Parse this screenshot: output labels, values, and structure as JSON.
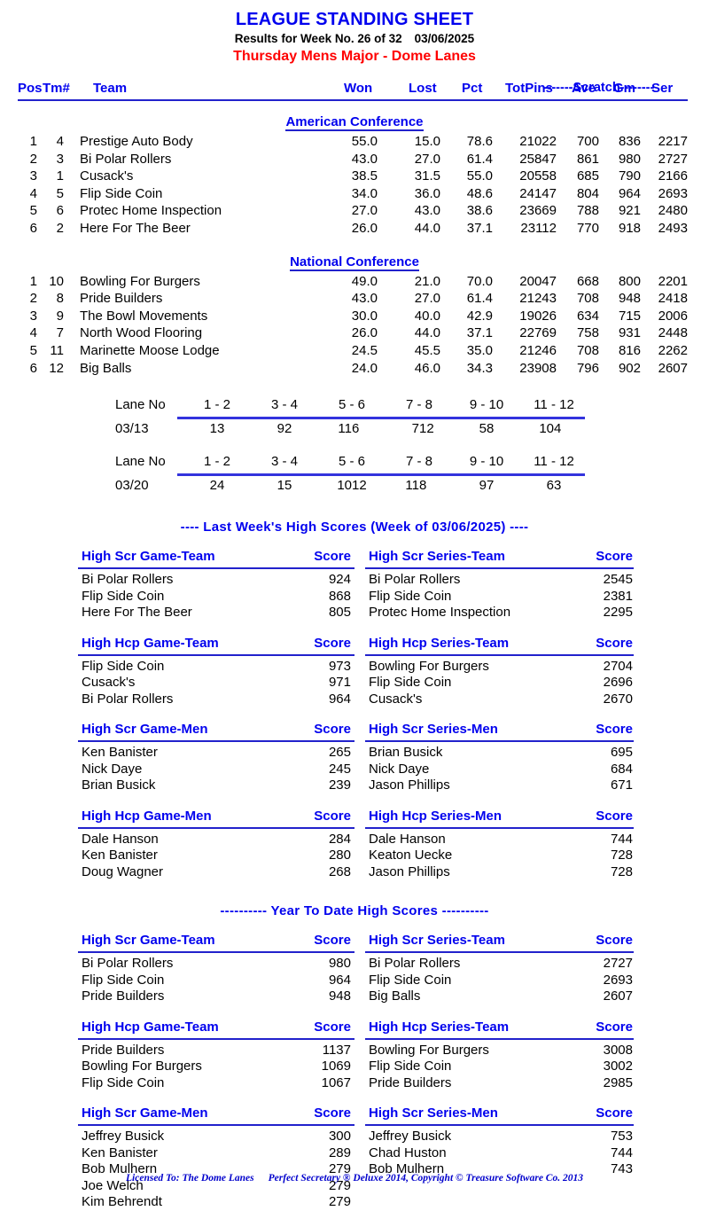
{
  "header": {
    "title": "LEAGUE STANDING SHEET",
    "results_label": "Results for Week No. 26 of 32",
    "results_date": "03/06/2025",
    "league_name": "Thursday Mens Major - Dome Lanes"
  },
  "standings": {
    "scratch_label": "-------Scratch--------",
    "columns": {
      "pos": "Pos",
      "tm": "Tm#",
      "team": "Team",
      "won": "Won",
      "lost": "Lost",
      "pct": "Pct",
      "totpins": "TotPins",
      "ave": "Ave",
      "gm": "Gm",
      "ser": "Ser"
    },
    "conferences": [
      {
        "name": "American Conference",
        "rows": [
          {
            "pos": "1",
            "tm": "4",
            "team": "Prestige Auto Body",
            "won": "55.0",
            "lost": "15.0",
            "pct": "78.6",
            "totpins": "21022",
            "ave": "700",
            "gm": "836",
            "ser": "2217"
          },
          {
            "pos": "2",
            "tm": "3",
            "team": "Bi Polar Rollers",
            "won": "43.0",
            "lost": "27.0",
            "pct": "61.4",
            "totpins": "25847",
            "ave": "861",
            "gm": "980",
            "ser": "2727"
          },
          {
            "pos": "3",
            "tm": "1",
            "team": "Cusack's",
            "won": "38.5",
            "lost": "31.5",
            "pct": "55.0",
            "totpins": "20558",
            "ave": "685",
            "gm": "790",
            "ser": "2166"
          },
          {
            "pos": "4",
            "tm": "5",
            "team": "Flip Side Coin",
            "won": "34.0",
            "lost": "36.0",
            "pct": "48.6",
            "totpins": "24147",
            "ave": "804",
            "gm": "964",
            "ser": "2693"
          },
          {
            "pos": "5",
            "tm": "6",
            "team": "Protec Home Inspection",
            "won": "27.0",
            "lost": "43.0",
            "pct": "38.6",
            "totpins": "23669",
            "ave": "788",
            "gm": "921",
            "ser": "2480"
          },
          {
            "pos": "6",
            "tm": "2",
            "team": "Here For The Beer",
            "won": "26.0",
            "lost": "44.0",
            "pct": "37.1",
            "totpins": "23112",
            "ave": "770",
            "gm": "918",
            "ser": "2493"
          }
        ]
      },
      {
        "name": "National Conference",
        "rows": [
          {
            "pos": "1",
            "tm": "10",
            "team": "Bowling For Burgers",
            "won": "49.0",
            "lost": "21.0",
            "pct": "70.0",
            "totpins": "20047",
            "ave": "668",
            "gm": "800",
            "ser": "2201"
          },
          {
            "pos": "2",
            "tm": "8",
            "team": "Pride Builders",
            "won": "43.0",
            "lost": "27.0",
            "pct": "61.4",
            "totpins": "21243",
            "ave": "708",
            "gm": "948",
            "ser": "2418"
          },
          {
            "pos": "3",
            "tm": "9",
            "team": "The Bowl Movements",
            "won": "30.0",
            "lost": "40.0",
            "pct": "42.9",
            "totpins": "19026",
            "ave": "634",
            "gm": "715",
            "ser": "2006"
          },
          {
            "pos": "4",
            "tm": "7",
            "team": "North Wood Flooring",
            "won": "26.0",
            "lost": "44.0",
            "pct": "37.1",
            "totpins": "22769",
            "ave": "758",
            "gm": "931",
            "ser": "2448"
          },
          {
            "pos": "5",
            "tm": "11",
            "team": "Marinette Moose Lodge",
            "won": "24.5",
            "lost": "45.5",
            "pct": "35.0",
            "totpins": "21246",
            "ave": "708",
            "gm": "816",
            "ser": "2262"
          },
          {
            "pos": "6",
            "tm": "12",
            "team": "Big Balls",
            "won": "24.0",
            "lost": "46.0",
            "pct": "34.3",
            "totpins": "23908",
            "ave": "796",
            "gm": "902",
            "ser": "2607"
          }
        ]
      }
    ]
  },
  "lane_schedule": {
    "lane_label": "Lane No",
    "lane_pairs": [
      "1 - 2",
      "3 - 4",
      "5 - 6",
      "7 - 8",
      "9 - 10",
      "11 - 12"
    ],
    "weeks": [
      {
        "date": "03/13",
        "matchups": [
          {
            "a": "1",
            "b": "3"
          },
          {
            "a": "9",
            "b": "2"
          },
          {
            "a": "11",
            "b": "6"
          },
          {
            "a": "7",
            "b": "12"
          },
          {
            "a": "5",
            "b": "8"
          },
          {
            "a": "10",
            "b": "4"
          }
        ]
      },
      {
        "date": "03/20",
        "matchups": [
          {
            "a": "2",
            "b": "4"
          },
          {
            "a": "1",
            "b": "5"
          },
          {
            "a": "10",
            "b": "12"
          },
          {
            "a": "11",
            "b": "8"
          },
          {
            "a": "9",
            "b": "7"
          },
          {
            "a": "6",
            "b": "3"
          }
        ]
      }
    ]
  },
  "last_week": {
    "title": "----  Last Week's High Scores   (Week of 03/06/2025)  ----",
    "score_header": "Score",
    "groups": [
      {
        "left_header": "High Scr Game-Team",
        "right_header": "High Scr Series-Team",
        "rows": [
          {
            "nameL": "Bi Polar Rollers",
            "scoreL": "924",
            "nameR": "Bi Polar Rollers",
            "scoreR": "2545"
          },
          {
            "nameL": "Flip Side Coin",
            "scoreL": "868",
            "nameR": "Flip Side Coin",
            "scoreR": "2381"
          },
          {
            "nameL": "Here For The Beer",
            "scoreL": "805",
            "nameR": "Protec Home Inspection",
            "scoreR": "2295"
          }
        ]
      },
      {
        "left_header": "High Hcp Game-Team",
        "right_header": "High Hcp Series-Team",
        "rows": [
          {
            "nameL": "Flip Side Coin",
            "scoreL": "973",
            "nameR": "Bowling For Burgers",
            "scoreR": "2704"
          },
          {
            "nameL": "Cusack's",
            "scoreL": "971",
            "nameR": "Flip Side Coin",
            "scoreR": "2696"
          },
          {
            "nameL": "Bi Polar Rollers",
            "scoreL": "964",
            "nameR": "Cusack's",
            "scoreR": "2670"
          }
        ]
      },
      {
        "left_header": "High Scr Game-Men",
        "right_header": "High Scr Series-Men",
        "rows": [
          {
            "nameL": "Ken Banister",
            "scoreL": "265",
            "nameR": "Brian Busick",
            "scoreR": "695"
          },
          {
            "nameL": "Nick Daye",
            "scoreL": "245",
            "nameR": "Nick Daye",
            "scoreR": "684"
          },
          {
            "nameL": "Brian Busick",
            "scoreL": "239",
            "nameR": "Jason Phillips",
            "scoreR": "671"
          }
        ]
      },
      {
        "left_header": "High Hcp Game-Men",
        "right_header": "High Hcp Series-Men",
        "rows": [
          {
            "nameL": "Dale Hanson",
            "scoreL": "284",
            "nameR": "Dale Hanson",
            "scoreR": "744"
          },
          {
            "nameL": "Ken Banister",
            "scoreL": "280",
            "nameR": "Keaton Uecke",
            "scoreR": "728"
          },
          {
            "nameL": "Doug Wagner",
            "scoreL": "268",
            "nameR": "Jason Phillips",
            "scoreR": "728"
          }
        ]
      }
    ]
  },
  "year_to_date": {
    "title": "---------- Year To Date High Scores ----------",
    "score_header": "Score",
    "groups": [
      {
        "left_header": "High Scr Game-Team",
        "right_header": "High Scr Series-Team",
        "rows": [
          {
            "nameL": "Bi Polar Rollers",
            "scoreL": "980",
            "nameR": "Bi Polar Rollers",
            "scoreR": "2727"
          },
          {
            "nameL": "Flip Side Coin",
            "scoreL": "964",
            "nameR": "Flip Side Coin",
            "scoreR": "2693"
          },
          {
            "nameL": "Pride Builders",
            "scoreL": "948",
            "nameR": "Big Balls",
            "scoreR": "2607"
          }
        ]
      },
      {
        "left_header": "High Hcp Game-Team",
        "right_header": "High Hcp Series-Team",
        "rows": [
          {
            "nameL": "Pride Builders",
            "scoreL": "1137",
            "nameR": "Bowling For Burgers",
            "scoreR": "3008"
          },
          {
            "nameL": "Bowling For Burgers",
            "scoreL": "1069",
            "nameR": "Flip Side Coin",
            "scoreR": "3002"
          },
          {
            "nameL": "Flip Side Coin",
            "scoreL": "1067",
            "nameR": "Pride Builders",
            "scoreR": "2985"
          }
        ]
      },
      {
        "left_header": "High Scr Game-Men",
        "right_header": "High Scr Series-Men",
        "rows": [
          {
            "nameL": "Jeffrey Busick",
            "scoreL": "300",
            "nameR": "Jeffrey Busick",
            "scoreR": "753"
          },
          {
            "nameL": "Ken Banister",
            "scoreL": "289",
            "nameR": "Chad Huston",
            "scoreR": "744"
          },
          {
            "nameL": "Bob Mulhern",
            "scoreL": "279",
            "nameR": "Bob Mulhern",
            "scoreR": "743"
          },
          {
            "nameL": "Joe Welch",
            "scoreL": "279",
            "nameR": "",
            "scoreR": ""
          },
          {
            "nameL": "Kim Behrendt",
            "scoreL": "279",
            "nameR": "",
            "scoreR": ""
          }
        ]
      }
    ]
  },
  "footer": {
    "licensed_to": "Licensed To: The Dome Lanes",
    "software": "Perfect Secretary ® Deluxe  2014, Copyright © Treasure Software Co. 2013"
  },
  "colors": {
    "heading_blue": "#0000ee",
    "league_red": "#ff0000",
    "rule_blue": "#2222cc",
    "footer_blue": "#0000cc",
    "body_black": "#000000"
  }
}
